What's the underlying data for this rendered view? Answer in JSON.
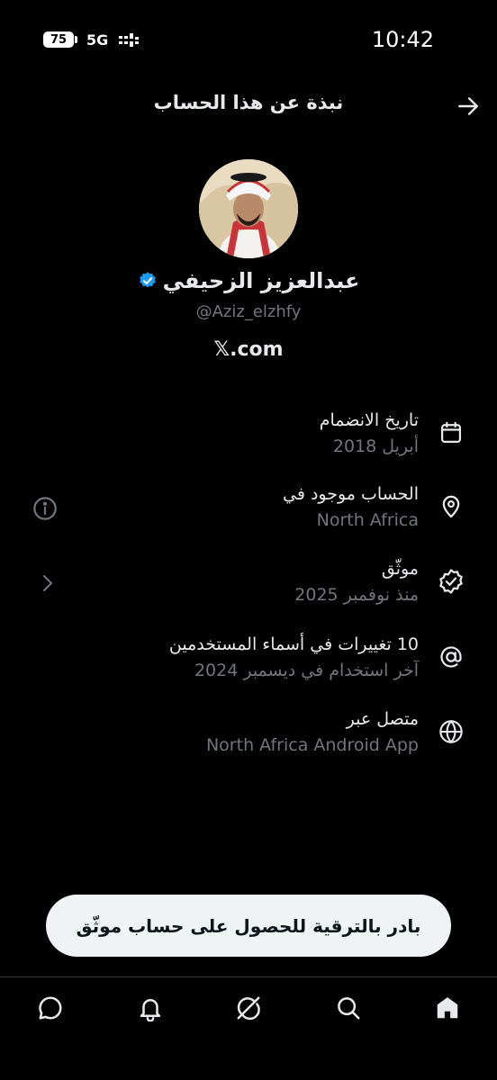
{
  "status_bar": {
    "battery": "75",
    "network": "5G",
    "time": "10:42"
  },
  "header": {
    "title": "نبذة عن هذا الحساب"
  },
  "profile": {
    "name": "عبدالعزيز الزحيفي",
    "handle": "@Aziz_elzhfy",
    "site": "𝕏.com",
    "verified_color": "#1d9bf0"
  },
  "rows": [
    {
      "icon": "calendar-icon",
      "title": "تاريخ الانضمام",
      "subtitle": "أبريل 2018"
    },
    {
      "icon": "location-pin-icon",
      "title": "الحساب موجود في",
      "subtitle": "North Africa"
    },
    {
      "icon": "verified-badge-icon",
      "title": "موثّق",
      "subtitle": "منذ نوفمبر 2025"
    },
    {
      "icon": "at-sign-icon",
      "title": "10 تغييرات في أسماء المستخدمين",
      "subtitle": "آخر استخدام في ديسمبر 2024"
    },
    {
      "icon": "globe-icon",
      "title": "متصل عبر",
      "subtitle": "North Africa Android App"
    }
  ],
  "upgrade_button": {
    "label": "بادر بالترقية للحصول على حساب موثّق"
  },
  "bottom_nav": [
    "home-icon",
    "search-icon",
    "grok-icon",
    "notifications-icon",
    "messages-icon"
  ],
  "colors": {
    "background": "#000000",
    "text": "#e7e9ea",
    "secondary": "#71767b",
    "accent": "#1d9bf0"
  }
}
